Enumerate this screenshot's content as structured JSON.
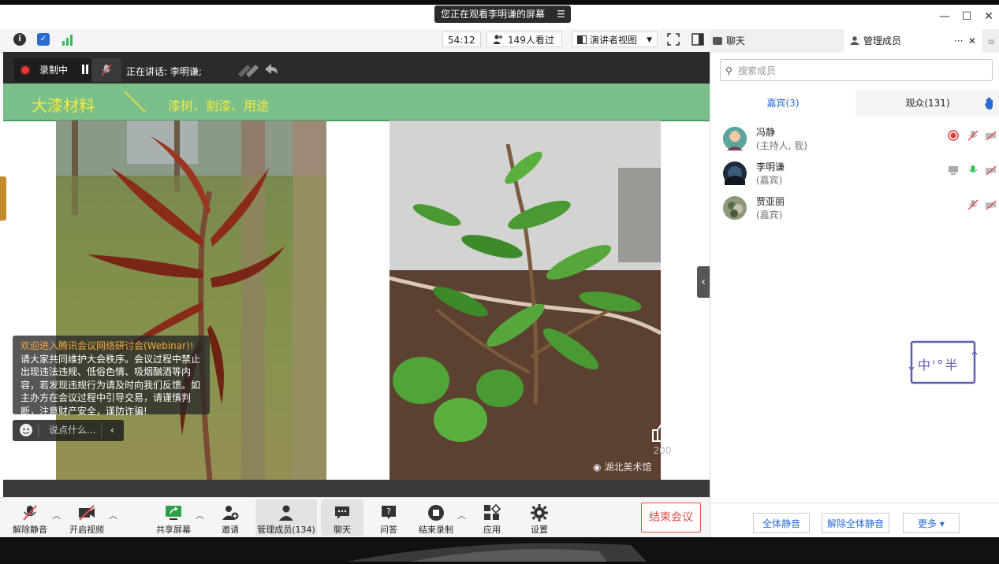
{
  "window": {
    "share_banner": "您正在观看李明谦的屏幕",
    "controls": {
      "minimize": "—",
      "maximize": "☐",
      "close": "✕"
    }
  },
  "topbar": {
    "timer": "54:12",
    "viewers": "149人看过",
    "view_mode": "演讲者视图"
  },
  "panel_tabs": {
    "chat": "聊天",
    "members": "管理成员",
    "more": "···",
    "close": "✕"
  },
  "recording": {
    "label": "录制中",
    "speaking": "正在讲话: 李明谦;"
  },
  "slide": {
    "title": "大漆材料",
    "subtitle": "漆树、割漆、用途",
    "watermark": "湖北美术馆",
    "like_count": "200"
  },
  "notice": {
    "heading": "欢迎进入腾讯会议网络研讨会(Webinar)!",
    "body": "请大家共同维护大会秩序。会议过程中禁止出现违法违规、低俗色情、吸烟酗酒等内容，若发现违规行为请及时向我们反馈。如主办方在会议过程中引导交易，请谨慎判断，注意财产安全，谨防诈骗!"
  },
  "chat_input": {
    "placeholder": "说点什么..."
  },
  "toolbar": {
    "unmute": "解除静音",
    "start_video": "开启视频",
    "share_screen": "共享屏幕",
    "invite": "邀请",
    "manage_members": "管理成员(134)",
    "chat": "聊天",
    "qa": "问答",
    "end_recording": "结束录制",
    "apps": "应用",
    "settings": "设置",
    "end_meeting": "结束会议"
  },
  "panel": {
    "search_placeholder": "搜索成员",
    "tab_guests": "嘉宾(3)",
    "tab_audience": "观众(131)",
    "members": [
      {
        "name": "冯静",
        "role": "(主持人, 我)"
      },
      {
        "name": "李明谦",
        "role": "(嘉宾)"
      },
      {
        "name": "贾亚丽",
        "role": "(嘉宾)"
      }
    ],
    "footer": {
      "mute_all": "全体静音",
      "unmute_all": "解除全体静音",
      "more": "更多 ▾"
    }
  },
  "sticker": {
    "text": "中'°半"
  },
  "colors": {
    "banner_green": "#7bbf8b",
    "banner_text": "#f8ea3b",
    "accent_blue": "#2a6bd1",
    "end_red": "#e04b4b",
    "record_red": "#e53935"
  }
}
